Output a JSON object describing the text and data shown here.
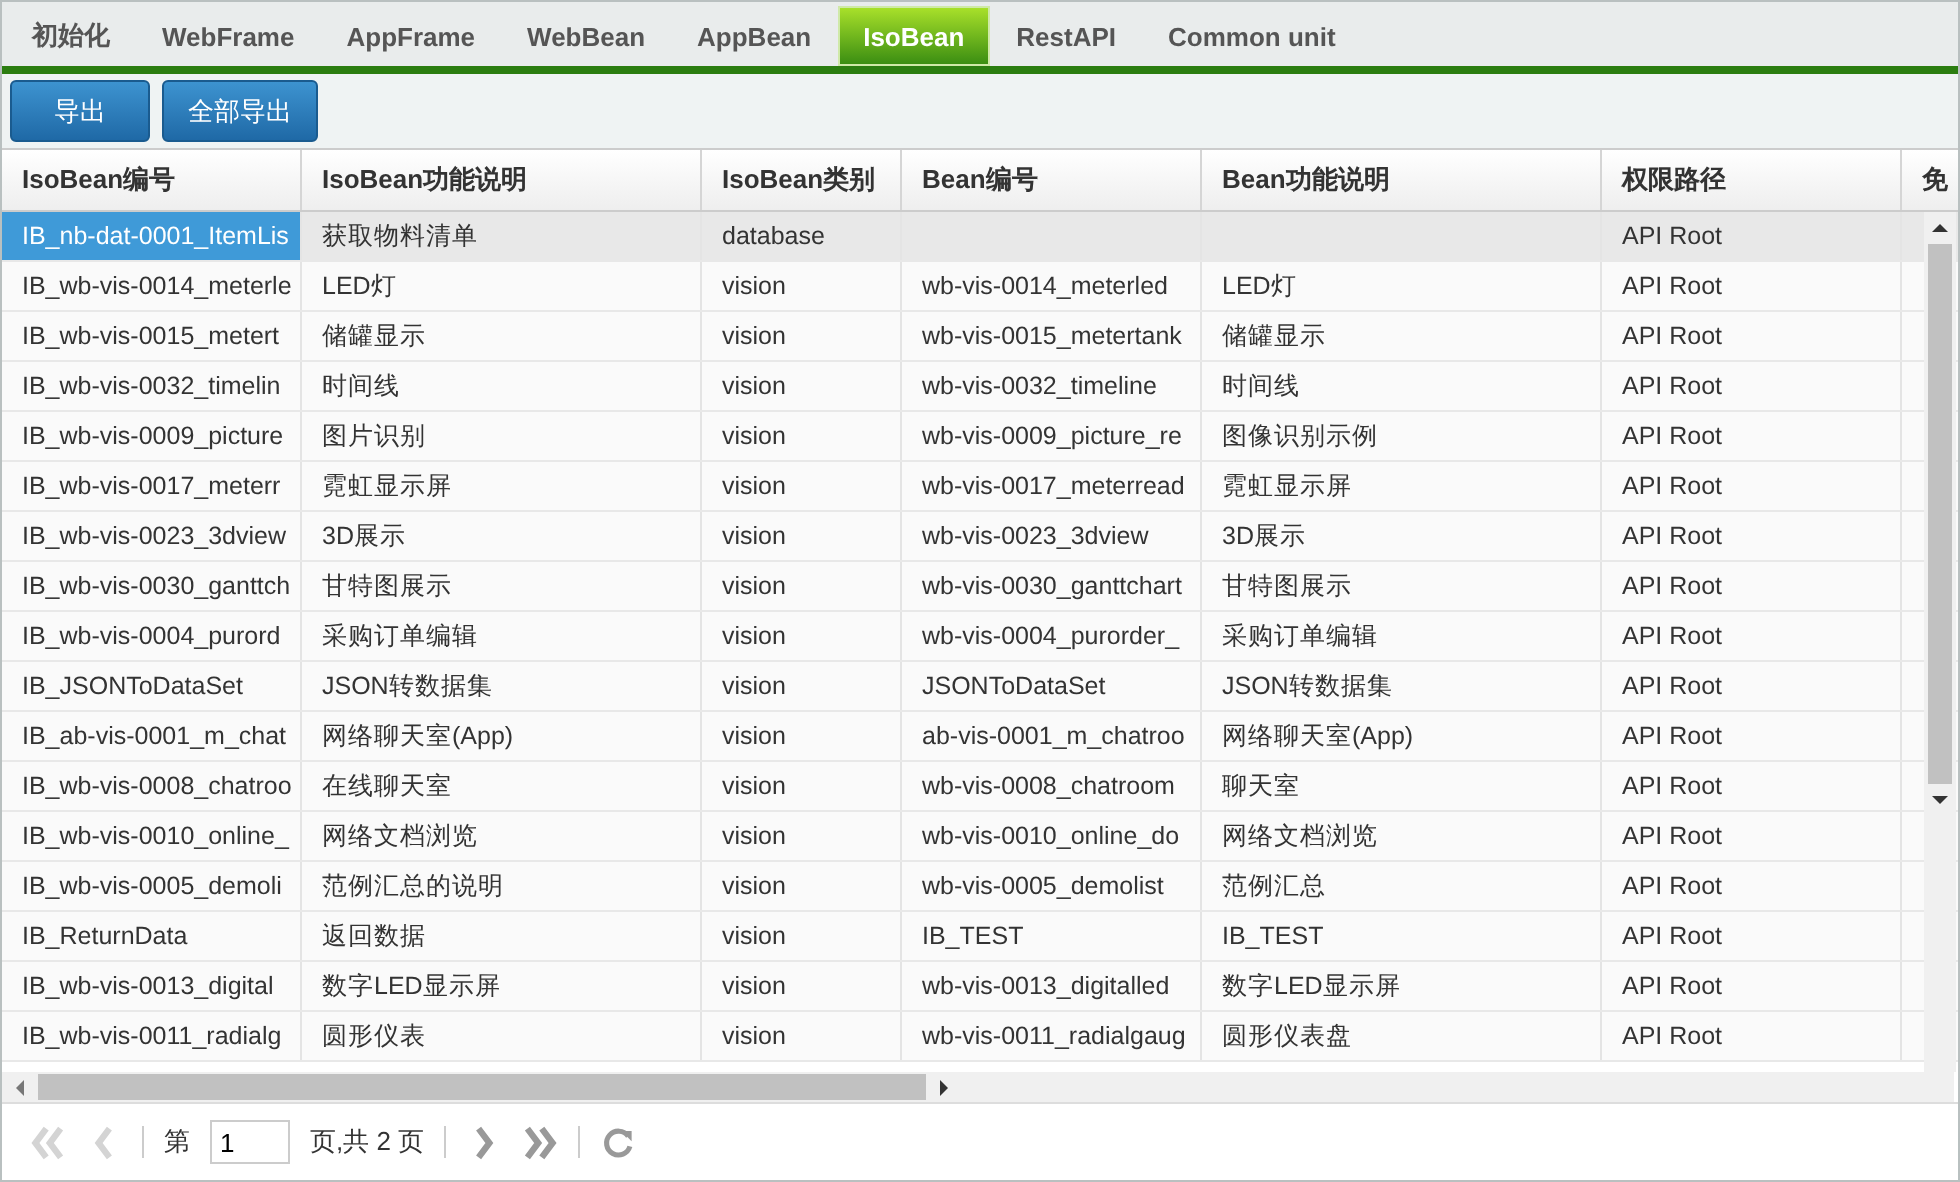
{
  "tabs": [
    {
      "label": "初始化",
      "selected": false
    },
    {
      "label": "WebFrame",
      "selected": false
    },
    {
      "label": "AppFrame",
      "selected": false
    },
    {
      "label": "WebBean",
      "selected": false
    },
    {
      "label": "AppBean",
      "selected": false
    },
    {
      "label": "IsoBean",
      "selected": true
    },
    {
      "label": "RestAPI",
      "selected": false
    },
    {
      "label": "Common unit",
      "selected": false
    }
  ],
  "toolbar": [
    "导出",
    "全部导出"
  ],
  "table": {
    "columns": [
      "IsoBean编号",
      "IsoBean功能说明",
      "IsoBean类别",
      "Bean编号",
      "Bean功能说明",
      "权限路径",
      "免"
    ],
    "rows": [
      {
        "selected": true,
        "cells": [
          "IB_nb-dat-0001_ItemLis",
          "获取物料清单",
          "database",
          "",
          "",
          "API Root"
        ]
      },
      {
        "selected": false,
        "cells": [
          "IB_wb-vis-0014_meterle",
          "LED灯",
          "vision",
          "wb-vis-0014_meterled",
          "LED灯",
          "API Root"
        ]
      },
      {
        "selected": false,
        "cells": [
          "IB_wb-vis-0015_metert",
          "储罐显示",
          "vision",
          "wb-vis-0015_metertank",
          "储罐显示",
          "API Root"
        ]
      },
      {
        "selected": false,
        "cells": [
          "IB_wb-vis-0032_timelin",
          "时间线",
          "vision",
          "wb-vis-0032_timeline",
          "时间线",
          "API Root"
        ]
      },
      {
        "selected": false,
        "cells": [
          "IB_wb-vis-0009_picture",
          "图片识别",
          "vision",
          "wb-vis-0009_picture_re",
          "图像识别示例",
          "API Root"
        ]
      },
      {
        "selected": false,
        "cells": [
          "IB_wb-vis-0017_meterr",
          "霓虹显示屏",
          "vision",
          "wb-vis-0017_meterread",
          "霓虹显示屏",
          "API Root"
        ]
      },
      {
        "selected": false,
        "cells": [
          "IB_wb-vis-0023_3dview",
          "3D展示",
          "vision",
          "wb-vis-0023_3dview",
          "3D展示",
          "API Root"
        ]
      },
      {
        "selected": false,
        "cells": [
          "IB_wb-vis-0030_ganttch",
          "甘特图展示",
          "vision",
          "wb-vis-0030_ganttchart",
          "甘特图展示",
          "API Root"
        ]
      },
      {
        "selected": false,
        "cells": [
          "IB_wb-vis-0004_purord",
          "采购订单编辑",
          "vision",
          "wb-vis-0004_purorder_",
          "采购订单编辑",
          "API Root"
        ]
      },
      {
        "selected": false,
        "cells": [
          "IB_JSONToDataSet",
          "JSON转数据集",
          "vision",
          "JSONToDataSet",
          "JSON转数据集",
          "API Root"
        ]
      },
      {
        "selected": false,
        "cells": [
          "IB_ab-vis-0001_m_chat",
          "网络聊天室(App)",
          "vision",
          "ab-vis-0001_m_chatroo",
          "网络聊天室(App)",
          "API Root"
        ]
      },
      {
        "selected": false,
        "cells": [
          "IB_wb-vis-0008_chatroo",
          "在线聊天室",
          "vision",
          "wb-vis-0008_chatroom",
          "聊天室",
          "API Root"
        ]
      },
      {
        "selected": false,
        "cells": [
          "IB_wb-vis-0010_online_",
          "网络文档浏览",
          "vision",
          "wb-vis-0010_online_do",
          "网络文档浏览",
          "API Root"
        ]
      },
      {
        "selected": false,
        "cells": [
          "IB_wb-vis-0005_demoli",
          "范例汇总的说明",
          "vision",
          "wb-vis-0005_demolist",
          "范例汇总",
          "API Root"
        ]
      },
      {
        "selected": false,
        "cells": [
          "IB_ReturnData",
          "返回数据",
          "vision",
          "IB_TEST",
          "IB_TEST",
          "API Root"
        ]
      },
      {
        "selected": false,
        "cells": [
          "IB_wb-vis-0013_digital",
          "数字LED显示屏",
          "vision",
          "wb-vis-0013_digitalled",
          "数字LED显示屏",
          "API Root"
        ]
      },
      {
        "selected": false,
        "cells": [
          "IB_wb-vis-0011_radialg",
          "圆形仪表",
          "vision",
          "wb-vis-0011_radialgaug",
          "圆形仪表盘",
          "API Root"
        ]
      }
    ]
  },
  "pager": {
    "before": "第",
    "page": "1",
    "after": "页,共 2 页",
    "first_disabled": true,
    "prev_disabled": true,
    "next_disabled": false,
    "last_disabled": false
  }
}
